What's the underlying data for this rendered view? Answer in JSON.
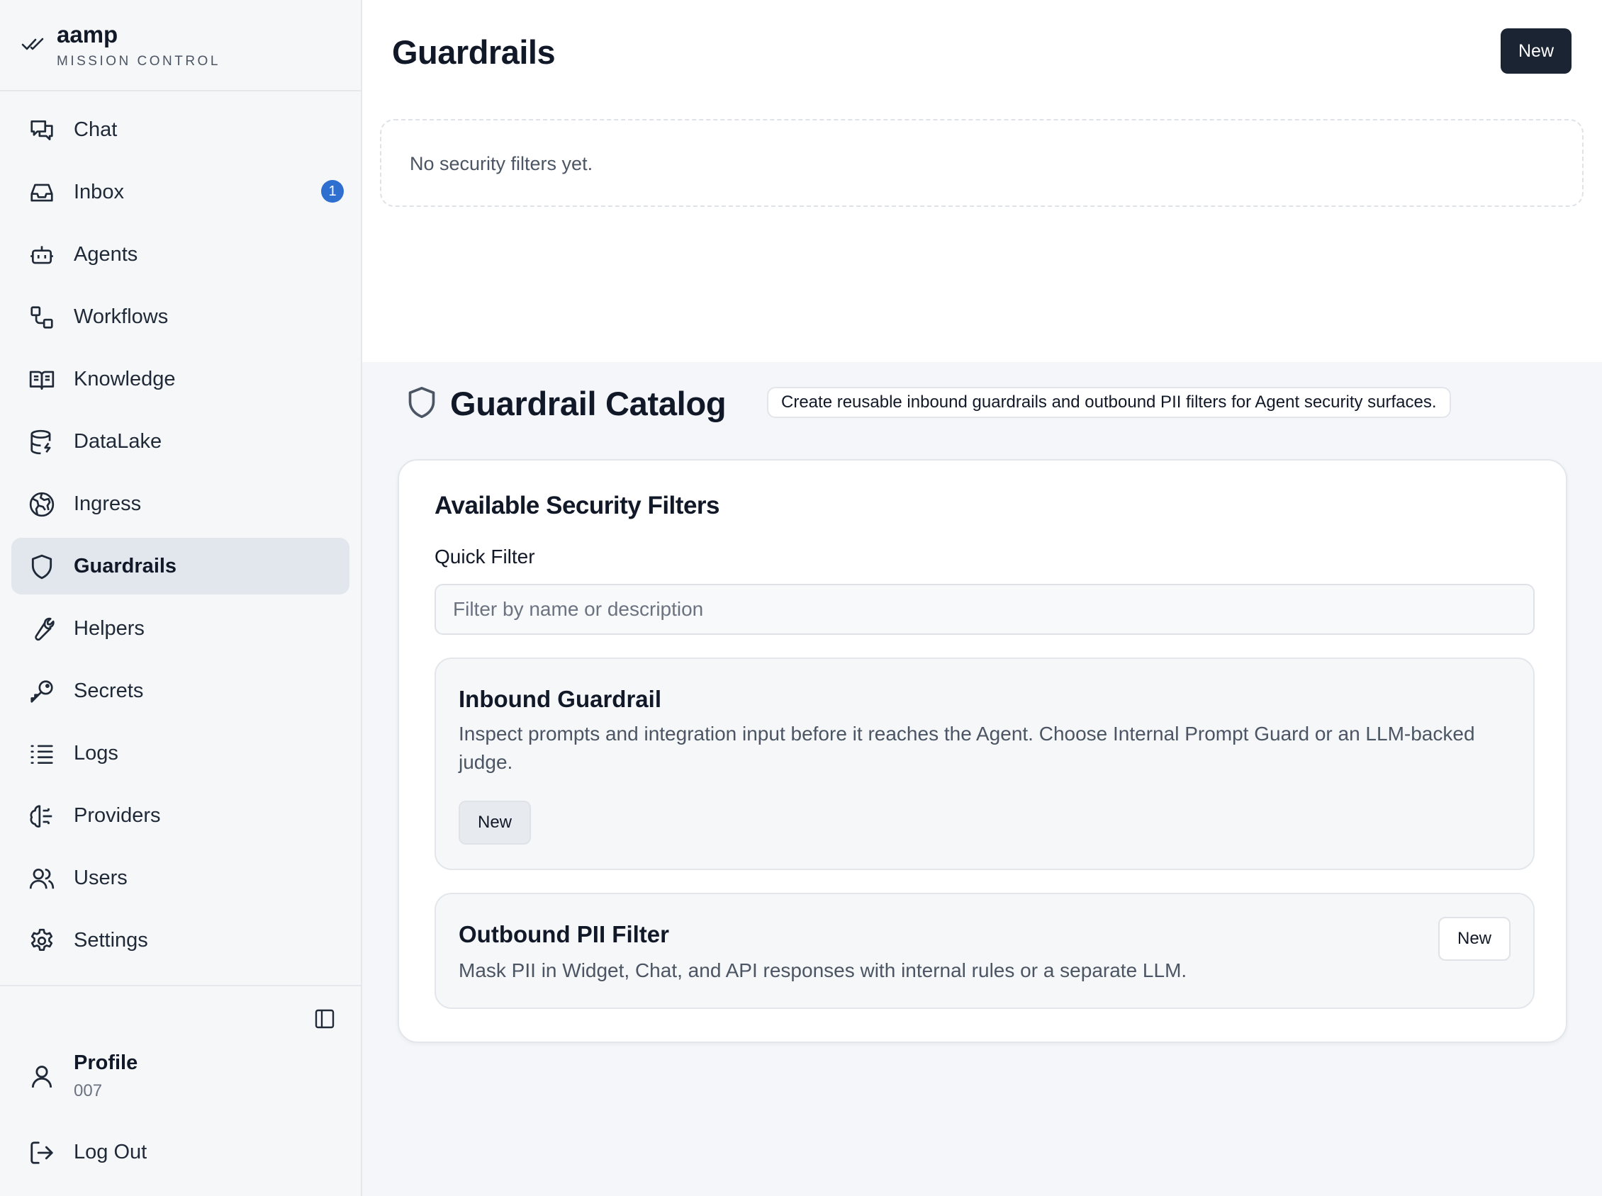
{
  "brand": {
    "name": "aamp",
    "subtitle": "MISSION CONTROL"
  },
  "sidebar": {
    "items": [
      {
        "label": "Chat",
        "icon": "chat-icon"
      },
      {
        "label": "Inbox",
        "icon": "inbox-icon",
        "badge": "1"
      },
      {
        "label": "Agents",
        "icon": "bot-icon"
      },
      {
        "label": "Workflows",
        "icon": "workflow-icon"
      },
      {
        "label": "Knowledge",
        "icon": "book-icon"
      },
      {
        "label": "DataLake",
        "icon": "database-icon"
      },
      {
        "label": "Ingress",
        "icon": "globe-icon"
      },
      {
        "label": "Guardrails",
        "icon": "shield-icon",
        "active": true
      },
      {
        "label": "Helpers",
        "icon": "wrench-icon"
      },
      {
        "label": "Secrets",
        "icon": "key-icon"
      },
      {
        "label": "Logs",
        "icon": "list-icon"
      },
      {
        "label": "Providers",
        "icon": "brain-icon"
      },
      {
        "label": "Users",
        "icon": "users-icon"
      },
      {
        "label": "Settings",
        "icon": "gear-icon"
      }
    ],
    "profile": {
      "label": "Profile",
      "id": "007"
    },
    "logout_label": "Log Out"
  },
  "header": {
    "title": "Guardrails",
    "new_label": "New"
  },
  "empty_state": "No security filters yet.",
  "catalog": {
    "title": "Guardrail Catalog",
    "description": "Create reusable inbound guardrails and outbound PII filters for Agent security surfaces.",
    "card_title": "Available Security Filters",
    "quick_filter_label": "Quick Filter",
    "quick_filter_placeholder": "Filter by name or description",
    "quick_filter_value": "",
    "filters": [
      {
        "name": "Inbound Guardrail",
        "description": "Inspect prompts and integration input before it reaches the Agent. Choose Internal Prompt Guard or an LLM-backed judge.",
        "button": "New"
      },
      {
        "name": "Outbound PII Filter",
        "description": "Mask PII in Widget, Chat, and API responses with internal rules or a separate LLM.",
        "button": "New"
      }
    ]
  },
  "colors": {
    "accent_dark": "#1b2433",
    "badge_blue": "#2f6fd0",
    "active_nav": "#e2e7ee",
    "page_bg": "#f4f6f9"
  }
}
